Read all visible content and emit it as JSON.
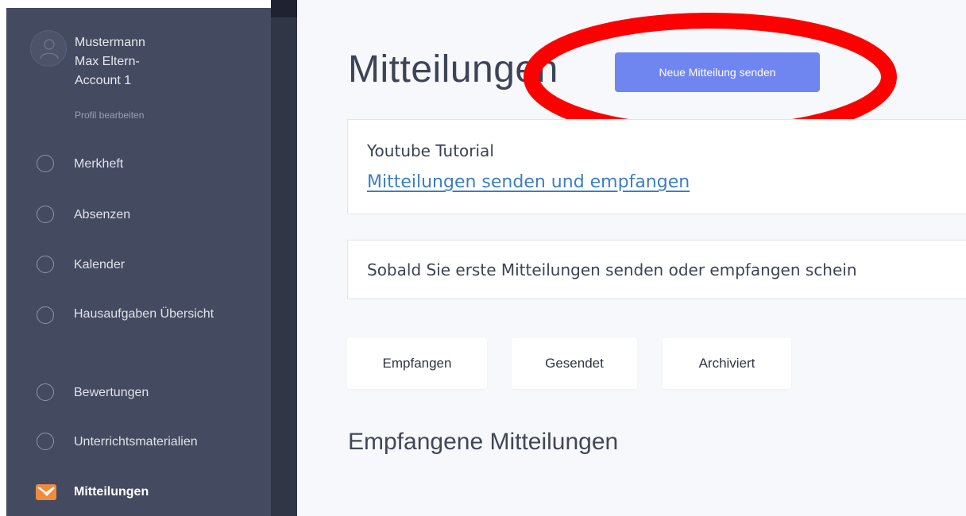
{
  "user": {
    "name_lines": [
      "Mustermann",
      "Max Eltern-",
      "Account 1"
    ],
    "edit_profile": "Profil bearbeiten"
  },
  "nav": {
    "merkheft": "Merkheft",
    "absenzen": "Absenzen",
    "kalender": "Kalender",
    "hausaufgaben": "Hausaufgaben Übersicht",
    "bewertungen": "Bewertungen",
    "unterrichtsmaterialien": "Unterrichtsmaterialien",
    "mitteilungen": "Mitteilungen"
  },
  "page": {
    "title": "Mitteilungen",
    "new_message_button": "Neue Mitteilung senden",
    "tutorial_label": "Youtube Tutorial",
    "tutorial_link": "Mitteilungen senden und empfangen",
    "empty_notice": "Sobald Sie erste Mitteilungen senden oder empfangen schein",
    "tabs": [
      "Empfangen",
      "Gesendet",
      "Archiviert"
    ],
    "section_title": "Empfangene Mitteilungen"
  },
  "colors": {
    "sidebar": "#444a60",
    "accent_button": "#6f86f0",
    "highlight_ring": "#ff0000",
    "link": "#3c7ec4",
    "mail_icon": "#f28a3c"
  },
  "icons": {
    "avatar": "user-avatar-icon",
    "nav_circle": "circle-icon",
    "mitteilungen": "mail-icon"
  }
}
